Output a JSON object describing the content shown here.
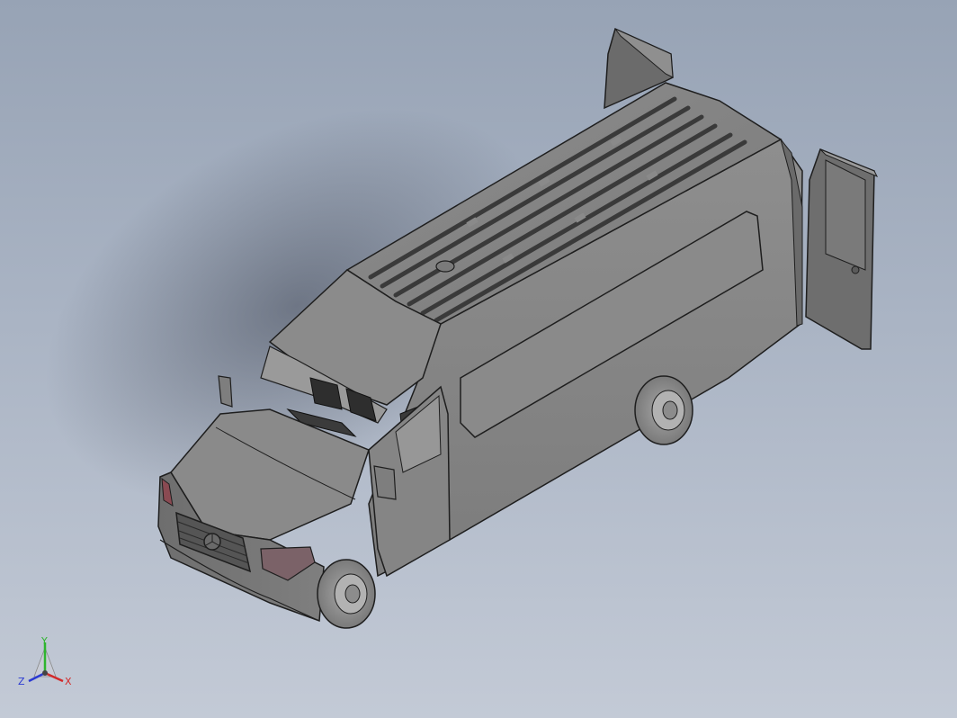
{
  "viewport": {
    "model": "van-assembly",
    "background_top": "#97a3b5",
    "background_bottom": "#c3cad6"
  },
  "triad": {
    "y_label": "Y",
    "z_label": "Z",
    "x_label": "X",
    "y_color": "#2fb52f",
    "x_color": "#d22a2a",
    "z_color": "#2a3ad2"
  }
}
